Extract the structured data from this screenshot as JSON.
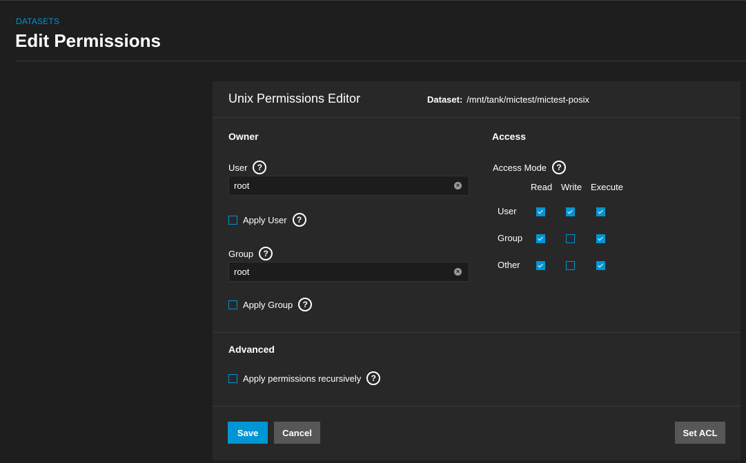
{
  "breadcrumb": "DATASETS",
  "page_title": "Edit Permissions",
  "editor": {
    "title": "Unix Permissions Editor",
    "dataset_label": "Dataset:",
    "dataset_path": "/mnt/tank/mictest/mictest-posix"
  },
  "owner": {
    "section_title": "Owner",
    "user_label": "User",
    "user_value": "root",
    "apply_user_label": "Apply User",
    "group_label": "Group",
    "group_value": "root",
    "apply_group_label": "Apply Group"
  },
  "access": {
    "section_title": "Access",
    "mode_label": "Access Mode",
    "columns": [
      "Read",
      "Write",
      "Execute"
    ],
    "rows": [
      {
        "label": "User",
        "checks": [
          true,
          true,
          true
        ]
      },
      {
        "label": "Group",
        "checks": [
          true,
          false,
          true
        ]
      },
      {
        "label": "Other",
        "checks": [
          true,
          false,
          true
        ]
      }
    ]
  },
  "advanced": {
    "section_title": "Advanced",
    "recursive_label": "Apply permissions recursively"
  },
  "buttons": {
    "save": "Save",
    "cancel": "Cancel",
    "set_acl": "Set ACL"
  },
  "icons": {
    "help": "help-circle-icon",
    "clear": "clear-circle-icon",
    "check": "checkmark-icon"
  },
  "colors": {
    "accent": "#0095d5",
    "background": "#1e1e1e",
    "card": "#282828",
    "secondary_button": "#575757"
  }
}
